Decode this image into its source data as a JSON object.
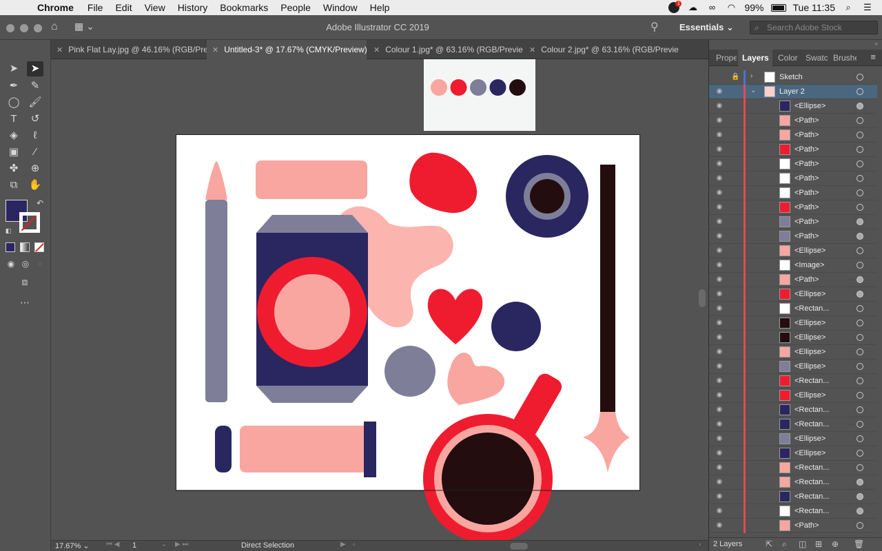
{
  "menubar": {
    "app": "Chrome",
    "menus": [
      "File",
      "Edit",
      "View",
      "History",
      "Bookmarks",
      "People",
      "Window",
      "Help"
    ],
    "battery": "99%",
    "clock": "Tue 11:35",
    "notification_count": "1"
  },
  "titlebar": {
    "title": "Adobe Illustrator CC 2019",
    "workspace": "Essentials",
    "search_placeholder": "Search Adobe Stock"
  },
  "tabs": [
    {
      "label": "Pink Flat Lay.jpg @ 46.16% (RGB/Pre..."
    },
    {
      "label": "Untitled-3* @ 17.67% (CMYK/Preview)"
    },
    {
      "label": "Colour 1.jpg* @ 63.16% (RGB/Previe..."
    },
    {
      "label": "Colour 2.jpg* @ 63.16% (RGB/Previe..."
    }
  ],
  "tools": {
    "fill_color": "#2b2661"
  },
  "palette": [
    "#f9a6a0",
    "#ef1c2f",
    "#7e7e99",
    "#2a2660",
    "#230d0e"
  ],
  "colors": {
    "pink": "#f9a6a0",
    "light_pink": "#fbb4ae",
    "red": "#ef1c2f",
    "grey": "#7e7e99",
    "navy": "#2a2660",
    "dark": "#230d0e"
  },
  "statusbar": {
    "zoom": "17.67%",
    "page": "1",
    "tool": "Direct Selection"
  },
  "panel": {
    "tabs": [
      "Prope",
      "Layers",
      "Color",
      "Swatc",
      "Brushe"
    ],
    "layers": [
      {
        "name": "Sketch",
        "type": "layer"
      },
      {
        "name": "Layer 2",
        "type": "layer"
      }
    ],
    "items": [
      {
        "name": "<Ellipse>",
        "thumb": "#2a2660",
        "target": "filled"
      },
      {
        "name": "<Path>",
        "thumb": "#f9a6a0",
        "target": "empty"
      },
      {
        "name": "<Path>",
        "thumb": "#f9a6a0",
        "target": "empty"
      },
      {
        "name": "<Path>",
        "thumb": "#ef1c2f",
        "target": "empty"
      },
      {
        "name": "<Path>",
        "thumb": "#ffffff",
        "target": "empty"
      },
      {
        "name": "<Path>",
        "thumb": "#ffffff",
        "target": "empty"
      },
      {
        "name": "<Path>",
        "thumb": "#ffffff",
        "target": "empty"
      },
      {
        "name": "<Path>",
        "thumb": "#ef1c2f",
        "target": "empty"
      },
      {
        "name": "<Path>",
        "thumb": "#7e7e99",
        "target": "filled"
      },
      {
        "name": "<Path>",
        "thumb": "#7e7e99",
        "target": "filled"
      },
      {
        "name": "<Ellipse>",
        "thumb": "#f9a6a0",
        "target": "empty"
      },
      {
        "name": "<Image>",
        "thumb": "#ffffff",
        "target": "empty"
      },
      {
        "name": "<Path>",
        "thumb": "#f9a6a0",
        "target": "filled"
      },
      {
        "name": "<Ellipse>",
        "thumb": "#ef1c2f",
        "target": "filled"
      },
      {
        "name": "<Rectan...",
        "thumb": "#ffffff",
        "target": "empty"
      },
      {
        "name": "<Ellipse>",
        "thumb": "#230d0e",
        "target": "empty"
      },
      {
        "name": "<Ellipse>",
        "thumb": "#230d0e",
        "target": "empty"
      },
      {
        "name": "<Ellipse>",
        "thumb": "#f9a6a0",
        "target": "empty"
      },
      {
        "name": "<Ellipse>",
        "thumb": "#7e7e99",
        "target": "empty"
      },
      {
        "name": "<Rectan...",
        "thumb": "#ef1c2f",
        "target": "empty"
      },
      {
        "name": "<Ellipse>",
        "thumb": "#ef1c2f",
        "target": "empty"
      },
      {
        "name": "<Rectan...",
        "thumb": "#2a2660",
        "target": "empty"
      },
      {
        "name": "<Rectan...",
        "thumb": "#2a2660",
        "target": "empty"
      },
      {
        "name": "<Ellipse>",
        "thumb": "#7e7e99",
        "target": "empty"
      },
      {
        "name": "<Ellipse>",
        "thumb": "#2a2660",
        "target": "empty"
      },
      {
        "name": "<Rectan...",
        "thumb": "#f9a6a0",
        "target": "empty"
      },
      {
        "name": "<Rectan...",
        "thumb": "#f9a6a0",
        "target": "filled"
      },
      {
        "name": "<Rectan...",
        "thumb": "#2a2660",
        "target": "filled"
      },
      {
        "name": "<Rectan...",
        "thumb": "#ffffff",
        "target": "filled"
      },
      {
        "name": "<Path>",
        "thumb": "#f9a6a0",
        "target": "empty"
      }
    ],
    "footer": "2 Layers"
  }
}
